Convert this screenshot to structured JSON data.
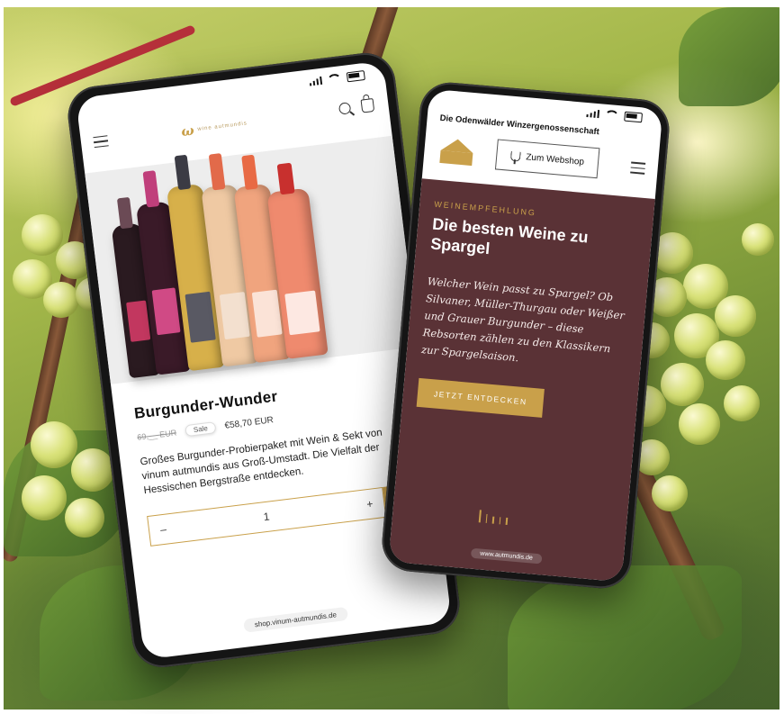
{
  "colors": {
    "gold": "#c9a04a",
    "wine": "#5a3236"
  },
  "left_phone": {
    "logo_text": "wine autmundis",
    "product": {
      "title": "Burgunder-Wunder",
      "old_price": "69,__ EUR",
      "sale_badge": "Sale",
      "price": "€58,70 EUR",
      "description": "Großes Burgunder-Probierpaket mit Wein & Sekt von vinum autmundis aus Groß-Umstadt. Die Vielfalt der Hessischen Bergstraße entdecken."
    },
    "cart": {
      "minus": "–",
      "quantity": "1",
      "plus": "+"
    },
    "url": "shop.vinum-autmundis.de",
    "icons": [
      "menu-icon",
      "search-icon",
      "bag-icon",
      "wine-glass-icon"
    ]
  },
  "right_phone": {
    "org_name": "Die Odenwälder Winzergenossenschaft",
    "shop_button": "Zum Webshop",
    "kicker": "WEINEMPFEHLUNG",
    "title": "Die besten Weine zu Spargel",
    "text": "Welcher Wein passt zu Spargel? Ob Silvaner, Müller-Thurgau oder Weißer und Grauer Burgunder – diese Rebsorten zählen zu den Klassikern zur Spargelsaison.",
    "cta": "JETZT ENTDECKEN",
    "url": "www.autmundis.de",
    "icons": [
      "logo-icon",
      "wine-glass-icon",
      "menu-icon"
    ]
  }
}
